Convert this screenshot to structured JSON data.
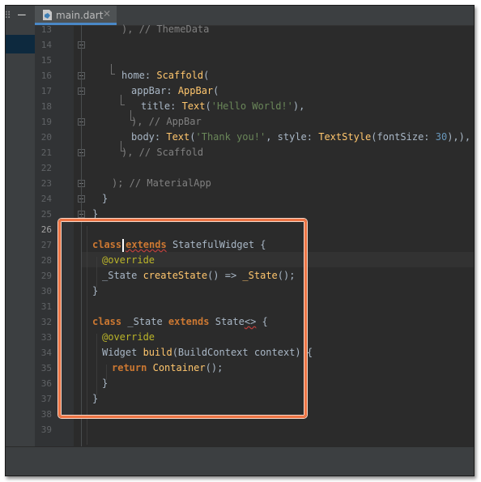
{
  "editor": {
    "tab": {
      "label": "main.dart",
      "close": "✕",
      "icon": "dart-file-icon"
    },
    "strip": {
      "dots": "⠿",
      "minimize": "—"
    },
    "line_numbers": [
      "13",
      "14",
      "15",
      "16",
      "17",
      "18",
      "19",
      "20",
      "21",
      "22",
      "23",
      "24",
      "25",
      "26",
      "27",
      "28",
      "29",
      "30",
      "31",
      "32",
      "33",
      "34",
      "35",
      "36",
      "37",
      "38",
      "39"
    ],
    "current_line": "26"
  },
  "code": {
    "l13": {
      "end": "), // ThemeData"
    },
    "l15": {
      "prop": "home",
      "colon": ": ",
      "cls": "Scaffold",
      "paren": "("
    },
    "l16": {
      "prop": "appBar",
      "colon": ": ",
      "cls": "AppBar",
      "paren": "("
    },
    "l17": {
      "prop": "title",
      "colon": ": ",
      "cls": "Text",
      "open": "(",
      "str": "'Hello World!'",
      "close": "),"
    },
    "l18": {
      "end": "), // AppBar"
    },
    "l19": {
      "prop": "body",
      "colon": ": ",
      "cls": "Text",
      "open": "(",
      "str": "'Thank you!'",
      "mid": ", style: ",
      "cls2": "TextStyle",
      "args": "(fontSize: ",
      "num": "30",
      "close": "),),"
    },
    "l20": {
      "end": "), // Scaffold"
    },
    "l22": {
      "end": "); // MaterialApp"
    },
    "l23": {
      "text": "}"
    },
    "l24": {
      "text": "}"
    },
    "l26": {
      "kw": "class",
      "kw2": "extends",
      "rest": "StatefulWidget {"
    },
    "l27": {
      "ann": "@override"
    },
    "l28": {
      "type": "_State ",
      "fn": "createState",
      "mid": "() => ",
      "fn2": "_State",
      "end": "();"
    },
    "l29": {
      "text": "}"
    },
    "l31": {
      "kw": "class",
      "name": " _State ",
      "kw2": "extends",
      "sp": " State",
      "gen": "<>",
      "end": " {"
    },
    "l32": {
      "ann": "@override"
    },
    "l33": {
      "type": "Widget ",
      "fn": "build",
      "rest": "(BuildContext context) {"
    },
    "l34": {
      "kw": "return",
      "sp": " ",
      "cls": "Container",
      "end": "();"
    },
    "l35": {
      "text": "}"
    },
    "l36": {
      "text": "}"
    }
  },
  "colors": {
    "highlight": "#ed7444",
    "background": "#2b2b2b",
    "keyword": "#cc7832",
    "string": "#6a8759"
  }
}
